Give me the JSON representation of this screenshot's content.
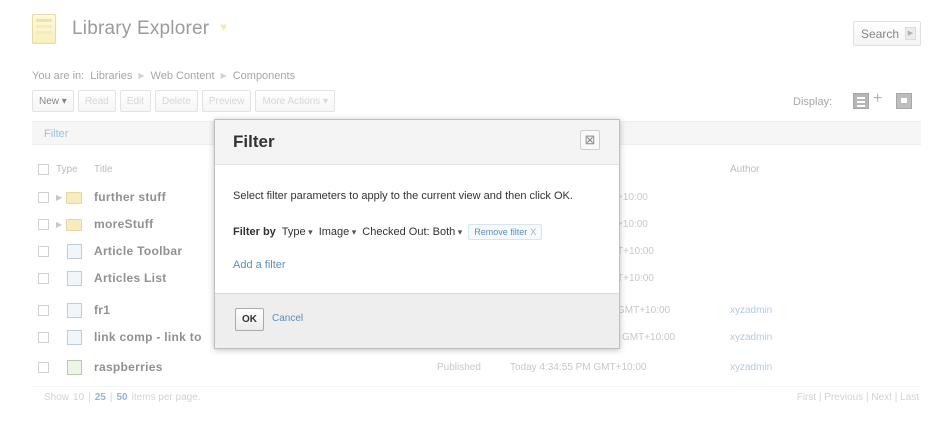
{
  "header": {
    "title": "Library Explorer",
    "search_label": "Search"
  },
  "breadcrumb": {
    "prefix": "You are in:",
    "items": [
      "Libraries",
      "Web Content",
      "Components"
    ]
  },
  "toolbar": {
    "new_label": "New",
    "read_label": "Read",
    "edit_label": "Edit",
    "delete_label": "Delete",
    "preview_label": "Preview",
    "more_actions_label": "More Actions",
    "display_label": "Display:"
  },
  "filter_link": "Filter",
  "table": {
    "headers": {
      "type": "Type",
      "title": "Title",
      "author": "Author"
    },
    "rows": [
      {
        "title": "further stuff",
        "kind": "folder",
        "status": "",
        "date": "+10:00",
        "author": ""
      },
      {
        "title": "moreStuff",
        "kind": "folder",
        "status": "",
        "date": "+10:00",
        "author": ""
      },
      {
        "title": "Article Toolbar",
        "kind": "component",
        "status": "",
        "date": "T+10:00",
        "author": ""
      },
      {
        "title": "Articles List",
        "kind": "component",
        "status": "",
        "date": "T+10:00",
        "author": ""
      },
      {
        "title": "fr1",
        "kind": "component",
        "status": "",
        "date": "GMT+10:00",
        "author": "xyzadmin"
      },
      {
        "title": "link comp - link to",
        "kind": "component",
        "status": "",
        "date": "l GMT+10:00",
        "author": "xyzadmin"
      },
      {
        "title": "raspberries",
        "kind": "image",
        "status": "Published",
        "date": "Today 4:34:55 PM GMT+10:00",
        "author": "xyzadmin"
      }
    ]
  },
  "paging": {
    "show_label": "Show",
    "sizes": [
      "10",
      "25",
      "50"
    ],
    "current_size": "25",
    "suffix": "items per page.",
    "nav": "First | Previous | Next | Last"
  },
  "dialog": {
    "title": "Filter",
    "close_symbol": "⊠",
    "intro": "Select filter parameters to apply to the current view and then click OK.",
    "filter_by_label": "Filter by",
    "filters": [
      "Type",
      "Image",
      "Checked Out: Both"
    ],
    "remove_filter_label": "Remove filter",
    "remove_filter_x": "X",
    "add_filter_label": "Add a filter",
    "ok_label": "OK",
    "cancel_label": "Cancel"
  }
}
